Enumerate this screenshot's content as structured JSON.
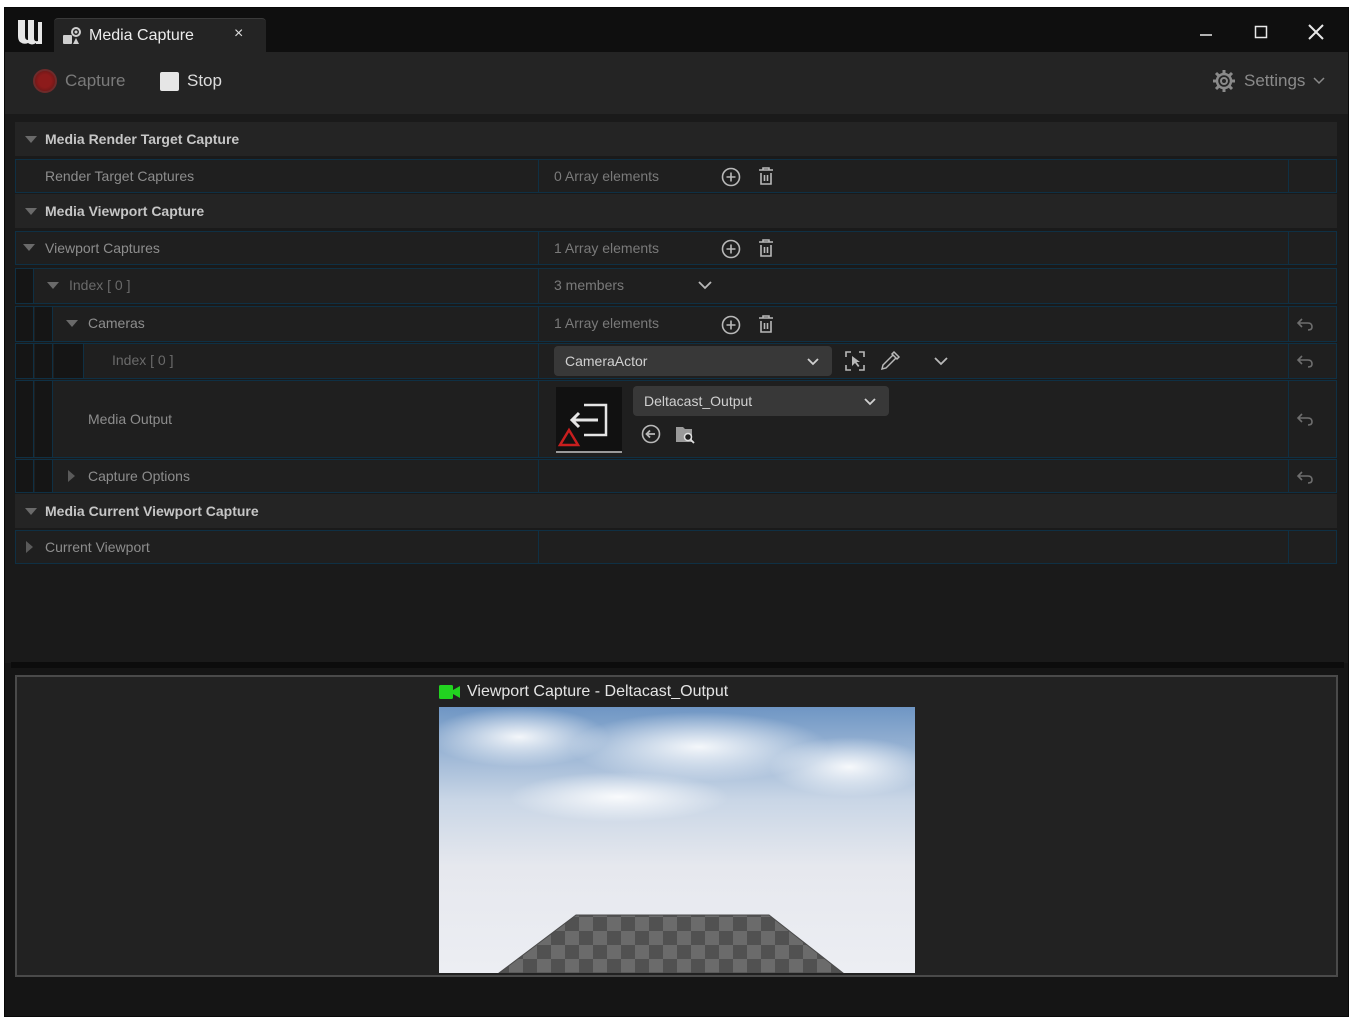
{
  "window": {
    "tab_title": "Media Capture",
    "tab_close": "×"
  },
  "toolbar": {
    "capture_label": "Capture",
    "stop_label": "Stop",
    "settings_label": "Settings"
  },
  "details": {
    "render_target_category": "Media Render Target Capture",
    "render_target_captures": {
      "label": "Render Target Captures",
      "value": "0 Array elements"
    },
    "viewport_category": "Media Viewport Capture",
    "viewport_captures": {
      "label": "Viewport Captures",
      "value": "1 Array elements"
    },
    "index0": {
      "label": "Index [ 0 ]",
      "value": "3 members"
    },
    "cameras": {
      "label": "Cameras",
      "value": "1 Array elements"
    },
    "camera_index0": {
      "label": "Index [ 0 ]",
      "value": "CameraActor"
    },
    "media_output": {
      "label": "Media Output",
      "value": "Deltacast_Output"
    },
    "capture_options": {
      "label": "Capture Options"
    },
    "current_viewport_category": "Media Current Viewport Capture",
    "current_viewport": {
      "label": "Current Viewport"
    }
  },
  "preview": {
    "title": "Viewport Capture - Deltacast_Output"
  },
  "colors": {
    "background": "#1a1a1a",
    "border_accent": "#0f3044",
    "record_red": "#8d1b1b",
    "camera_green": "#22d320"
  }
}
